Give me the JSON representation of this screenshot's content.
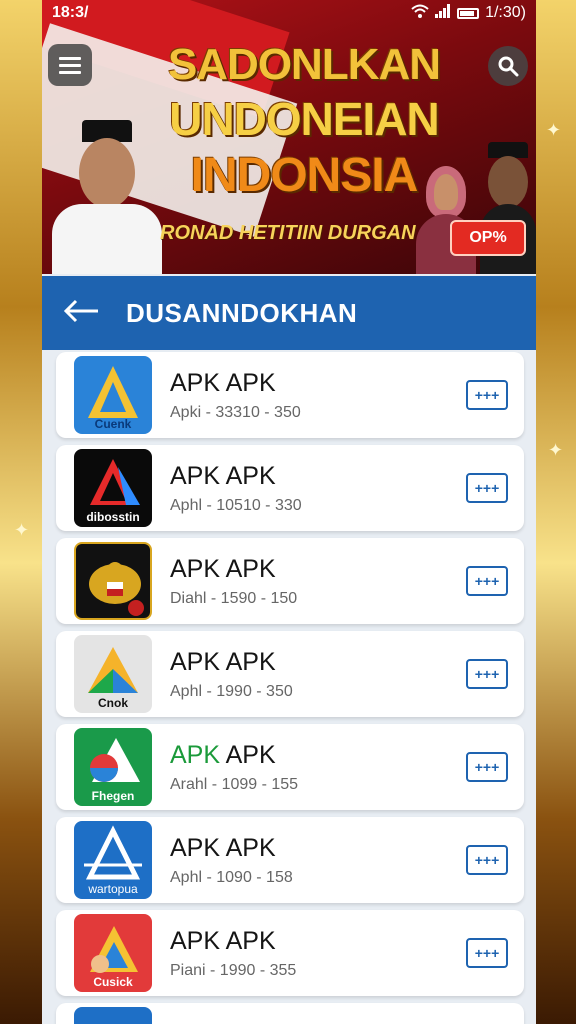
{
  "status_bar": {
    "time": "18:3/",
    "right_time": "1/:30)"
  },
  "banner": {
    "title_line1": "SADONLKAN",
    "title_line2": "UNDONEIAN",
    "title_line3": "INDONSIA",
    "subtitle": "RONAD HETITIIN DURGAN",
    "badge": "OP%"
  },
  "nav": {
    "title": "DUSANNDOKHAN"
  },
  "apps": [
    {
      "name": "APK APK",
      "meta": "Apki - 33310 - 350",
      "icon_label": "Cuenk",
      "bg": "#2a83d8",
      "accent": false
    },
    {
      "name": "APK APK",
      "meta": "Aphl - 10510 - 330",
      "icon_label": "dibosstin",
      "bg": "#0a0a0a",
      "accent": false
    },
    {
      "name": "APK APK",
      "meta": "Diahl - 1590 - 150",
      "icon_label": "",
      "bg": "#111111",
      "accent": false
    },
    {
      "name": "APK APK",
      "meta": "Aphl - 1990 - 350",
      "icon_label": "Cnok",
      "bg": "#e4e4e4",
      "accent": false
    },
    {
      "name_accent": "APK",
      "name_rest": " APK",
      "meta": "Arahl - 1099 - 155",
      "icon_label": "Fhegen",
      "bg": "#1a9a4a",
      "accent": true
    },
    {
      "name": "APK APK",
      "meta": "Aphl - 1090 - 158",
      "icon_label": "wartopua",
      "bg": "#1e6fc6",
      "accent": false
    },
    {
      "name": "APK APK",
      "meta": "Piani - 1990 - 355",
      "icon_label": "Cusick",
      "bg": "#e23a3a",
      "accent": false
    }
  ],
  "colors": {
    "primary": "#1e63b0",
    "banner_red": "#b31218",
    "gold": "#f2c23a"
  }
}
